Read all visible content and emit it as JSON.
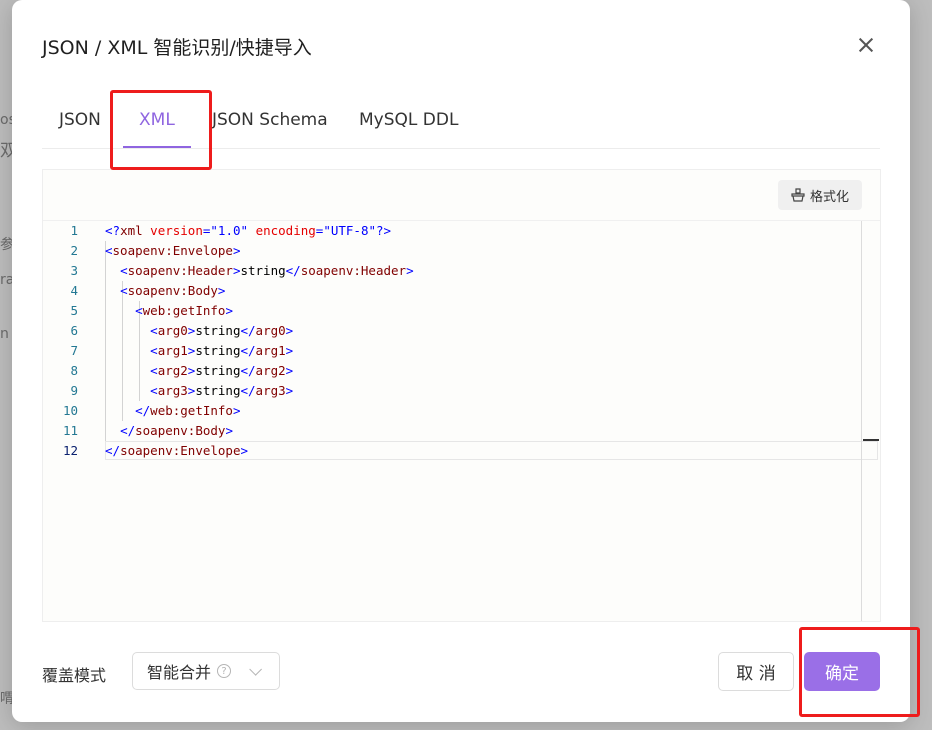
{
  "background": {
    "fragments": [
      "os",
      "双",
      "参",
      "ra",
      "n",
      "喟"
    ]
  },
  "dialog": {
    "title": "JSON / XML 智能识别/快捷导入",
    "close_icon": "close-icon"
  },
  "tabs": [
    {
      "label": "JSON",
      "active": false
    },
    {
      "label": "XML",
      "active": true
    },
    {
      "label": "JSON Schema",
      "active": false
    },
    {
      "label": "MySQL DDL",
      "active": false
    }
  ],
  "editor": {
    "format_button": "格式化",
    "format_icon": "broom-icon",
    "line_numbers": [
      "1",
      "2",
      "3",
      "4",
      "5",
      "6",
      "7",
      "8",
      "9",
      "10",
      "11",
      "12"
    ],
    "current_line": 12,
    "lines": [
      [
        [
          "delim",
          "<?"
        ],
        [
          "tag",
          "xml"
        ],
        [
          "text",
          " "
        ],
        [
          "attr",
          "version"
        ],
        [
          "delim",
          "="
        ],
        [
          "str",
          "\"1.0\""
        ],
        [
          "text",
          " "
        ],
        [
          "attr",
          "encoding"
        ],
        [
          "delim",
          "="
        ],
        [
          "str",
          "\"UTF-8\""
        ],
        [
          "delim",
          "?>"
        ]
      ],
      [
        [
          "delim",
          "<"
        ],
        [
          "tag",
          "soapenv:Envelope"
        ],
        [
          "delim",
          ">"
        ]
      ],
      [
        [
          "text",
          "  "
        ],
        [
          "delim",
          "<"
        ],
        [
          "tag",
          "soapenv:Header"
        ],
        [
          "delim",
          ">"
        ],
        [
          "text",
          "string"
        ],
        [
          "delim",
          "</"
        ],
        [
          "tag",
          "soapenv:Header"
        ],
        [
          "delim",
          ">"
        ]
      ],
      [
        [
          "text",
          "  "
        ],
        [
          "delim",
          "<"
        ],
        [
          "tag",
          "soapenv:Body"
        ],
        [
          "delim",
          ">"
        ]
      ],
      [
        [
          "text",
          "    "
        ],
        [
          "delim",
          "<"
        ],
        [
          "tag",
          "web:getInfo"
        ],
        [
          "delim",
          ">"
        ]
      ],
      [
        [
          "text",
          "      "
        ],
        [
          "delim",
          "<"
        ],
        [
          "tag",
          "arg0"
        ],
        [
          "delim",
          ">"
        ],
        [
          "text",
          "string"
        ],
        [
          "delim",
          "</"
        ],
        [
          "tag",
          "arg0"
        ],
        [
          "delim",
          ">"
        ]
      ],
      [
        [
          "text",
          "      "
        ],
        [
          "delim",
          "<"
        ],
        [
          "tag",
          "arg1"
        ],
        [
          "delim",
          ">"
        ],
        [
          "text",
          "string"
        ],
        [
          "delim",
          "</"
        ],
        [
          "tag",
          "arg1"
        ],
        [
          "delim",
          ">"
        ]
      ],
      [
        [
          "text",
          "      "
        ],
        [
          "delim",
          "<"
        ],
        [
          "tag",
          "arg2"
        ],
        [
          "delim",
          ">"
        ],
        [
          "text",
          "string"
        ],
        [
          "delim",
          "</"
        ],
        [
          "tag",
          "arg2"
        ],
        [
          "delim",
          ">"
        ]
      ],
      [
        [
          "text",
          "      "
        ],
        [
          "delim",
          "<"
        ],
        [
          "tag",
          "arg3"
        ],
        [
          "delim",
          ">"
        ],
        [
          "text",
          "string"
        ],
        [
          "delim",
          "</"
        ],
        [
          "tag",
          "arg3"
        ],
        [
          "delim",
          ">"
        ]
      ],
      [
        [
          "text",
          "    "
        ],
        [
          "delim",
          "</"
        ],
        [
          "tag",
          "web:getInfo"
        ],
        [
          "delim",
          ">"
        ]
      ],
      [
        [
          "text",
          "  "
        ],
        [
          "delim",
          "</"
        ],
        [
          "tag",
          "soapenv:Body"
        ],
        [
          "delim",
          ">"
        ]
      ],
      [
        [
          "delim",
          "</"
        ],
        [
          "tag",
          "soapenv:Envelope"
        ],
        [
          "delim",
          ">"
        ]
      ]
    ]
  },
  "footer": {
    "mode_label": "覆盖模式",
    "mode_value": "智能合并",
    "help_icon": "question-circle-icon",
    "dropdown_icon": "chevron-down-icon",
    "cancel_label": "取 消",
    "confirm_label": "确定"
  },
  "colors": {
    "accent": "#9a6fe7",
    "active_tab": "#8f65e0",
    "highlight_box": "#ee1c1c"
  }
}
